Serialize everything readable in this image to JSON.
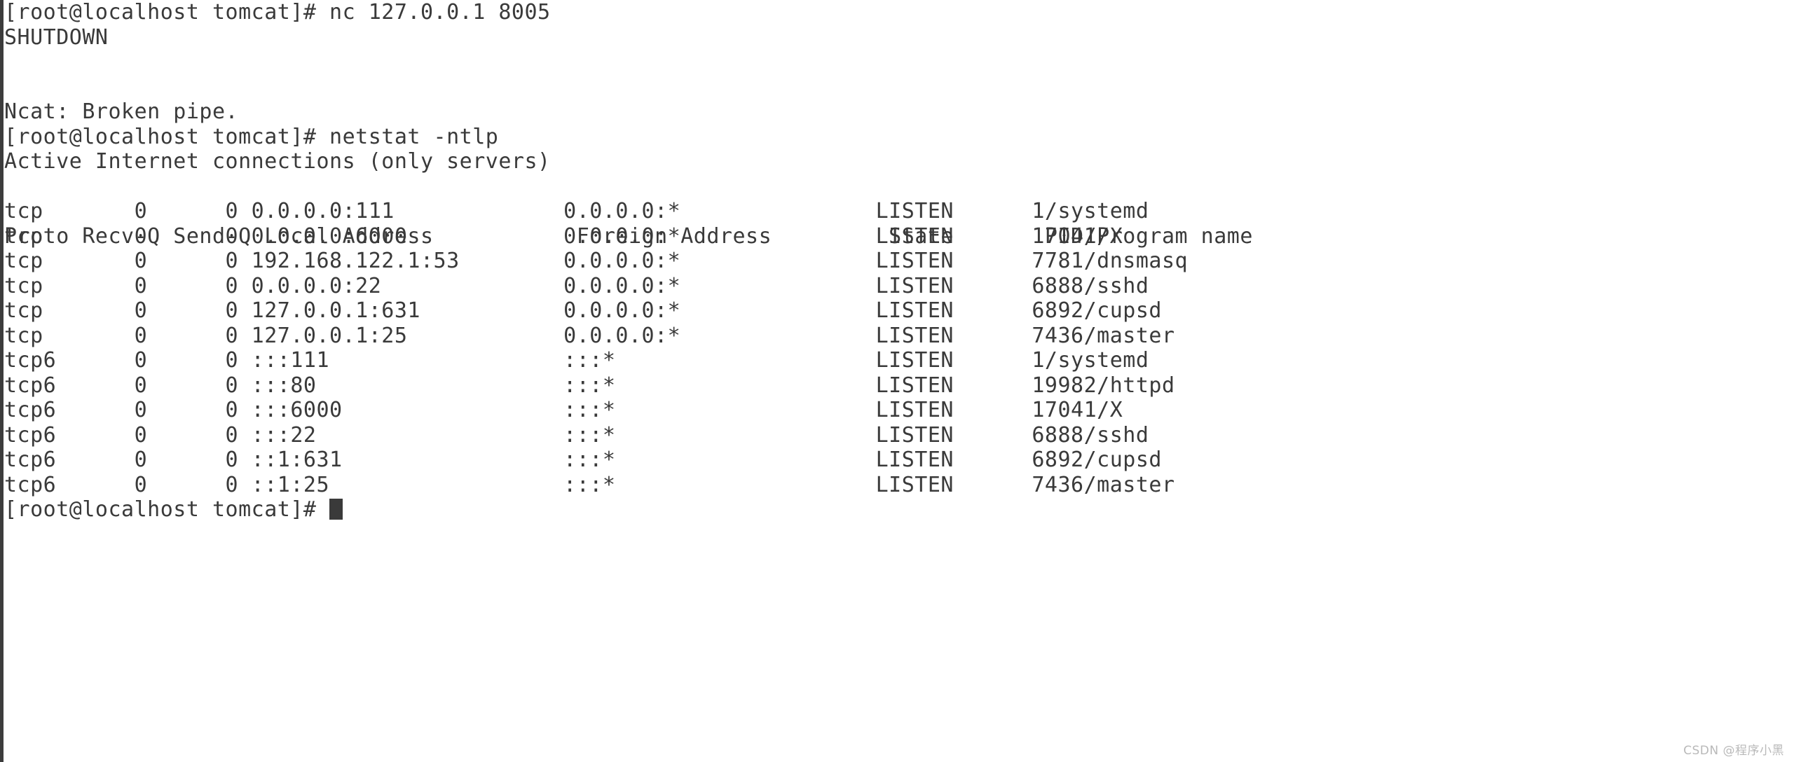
{
  "terminal": {
    "prompt": "[root@localhost tomcat]# ",
    "background_color": "#ffffff",
    "foreground_color": "#3a3a3a",
    "cursor": {
      "shape": "block",
      "color": "#3a3a3a"
    },
    "lines": [
      {
        "id": "line-1",
        "type": "command",
        "text": "[root@localhost tomcat]# nc 127.0.0.1 8005"
      },
      {
        "id": "line-2",
        "type": "input",
        "text": "SHUTDOWN"
      },
      {
        "id": "line-3",
        "type": "blank",
        "text": " "
      },
      {
        "id": "line-4",
        "type": "blank",
        "text": " "
      },
      {
        "id": "line-5",
        "type": "output",
        "text": "Ncat: Broken pipe."
      },
      {
        "id": "line-6",
        "type": "command",
        "text": "[root@localhost tomcat]# netstat -ntlp"
      },
      {
        "id": "line-7",
        "type": "output",
        "text": "Active Internet connections (only servers)"
      }
    ],
    "netstat": {
      "title": "Active Internet connections (only servers)",
      "command": "netstat -ntlp",
      "headers": {
        "proto": "Proto",
        "recv_q": "Recv-Q",
        "send_q": "Send-Q",
        "local_address": "Local Address",
        "foreign_address": "Foreign Address",
        "state": "State",
        "pid_program": "PID/Program name"
      },
      "header_line": "Proto Recv-Q Send-Q Local Address           Foreign Address         State       PID/Program name",
      "rows": [
        {
          "proto": "tcp",
          "recv_q": "0",
          "send_q": "0",
          "local_address": "0.0.0.0:111",
          "foreign_address": "0.0.0.0:*",
          "state": "LISTEN",
          "pid_program": "1/systemd"
        },
        {
          "proto": "tcp",
          "recv_q": "0",
          "send_q": "0",
          "local_address": "0.0.0.0:6000",
          "foreign_address": "0.0.0.0:*",
          "state": "LISTEN",
          "pid_program": "17041/X"
        },
        {
          "proto": "tcp",
          "recv_q": "0",
          "send_q": "0",
          "local_address": "192.168.122.1:53",
          "foreign_address": "0.0.0.0:*",
          "state": "LISTEN",
          "pid_program": "7781/dnsmasq"
        },
        {
          "proto": "tcp",
          "recv_q": "0",
          "send_q": "0",
          "local_address": "0.0.0.0:22",
          "foreign_address": "0.0.0.0:*",
          "state": "LISTEN",
          "pid_program": "6888/sshd"
        },
        {
          "proto": "tcp",
          "recv_q": "0",
          "send_q": "0",
          "local_address": "127.0.0.1:631",
          "foreign_address": "0.0.0.0:*",
          "state": "LISTEN",
          "pid_program": "6892/cupsd"
        },
        {
          "proto": "tcp",
          "recv_q": "0",
          "send_q": "0",
          "local_address": "127.0.0.1:25",
          "foreign_address": "0.0.0.0:*",
          "state": "LISTEN",
          "pid_program": "7436/master"
        },
        {
          "proto": "tcp6",
          "recv_q": "0",
          "send_q": "0",
          "local_address": ":::111",
          "foreign_address": ":::*",
          "state": "LISTEN",
          "pid_program": "1/systemd"
        },
        {
          "proto": "tcp6",
          "recv_q": "0",
          "send_q": "0",
          "local_address": ":::80",
          "foreign_address": ":::*",
          "state": "LISTEN",
          "pid_program": "19982/httpd"
        },
        {
          "proto": "tcp6",
          "recv_q": "0",
          "send_q": "0",
          "local_address": ":::6000",
          "foreign_address": ":::*",
          "state": "LISTEN",
          "pid_program": "17041/X"
        },
        {
          "proto": "tcp6",
          "recv_q": "0",
          "send_q": "0",
          "local_address": ":::22",
          "foreign_address": ":::*",
          "state": "LISTEN",
          "pid_program": "6888/sshd"
        },
        {
          "proto": "tcp6",
          "recv_q": "0",
          "send_q": "0",
          "local_address": "::1:631",
          "foreign_address": ":::*",
          "state": "LISTEN",
          "pid_program": "6892/cupsd"
        },
        {
          "proto": "tcp6",
          "recv_q": "0",
          "send_q": "0",
          "local_address": "::1:25",
          "foreign_address": ":::*",
          "state": "LISTEN",
          "pid_program": "7436/master"
        }
      ]
    },
    "final_prompt": "[root@localhost tomcat]# "
  },
  "watermark": {
    "text": "CSDN @程序小黑"
  }
}
